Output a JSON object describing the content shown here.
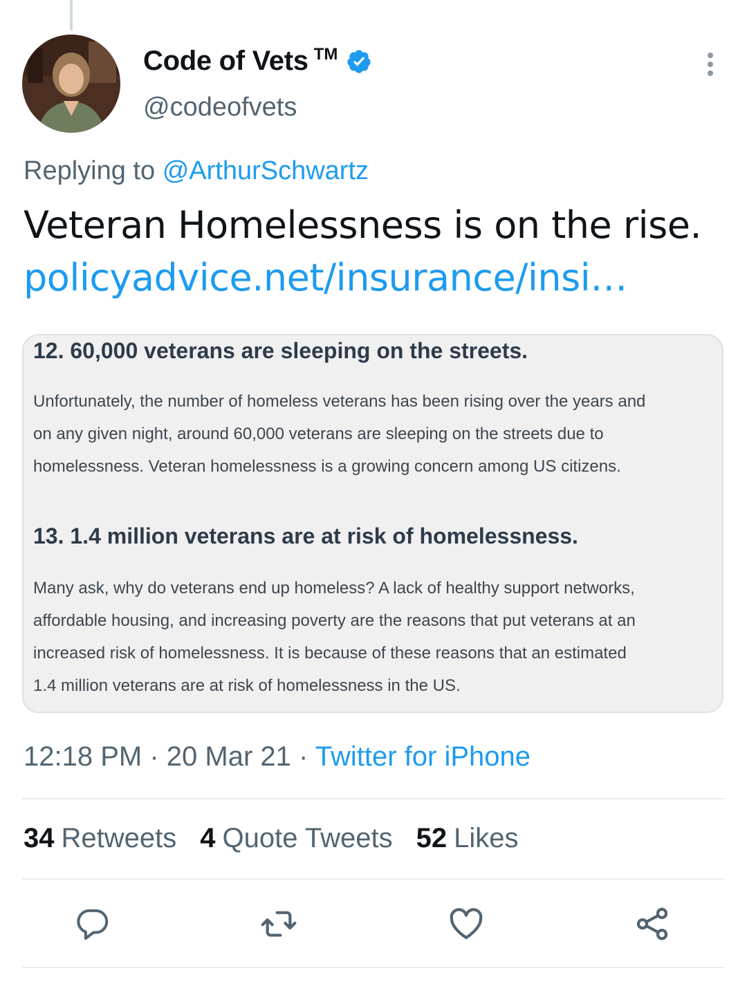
{
  "tweet": {
    "author": {
      "display_name": "Code of Vets",
      "tm": "TM",
      "handle": "@codeofvets"
    },
    "replying": {
      "prefix": "Replying to",
      "mention": "@ArthurSchwartz"
    },
    "text": "Veteran Homelessness is on the rise.",
    "link": "policyadvice.net/insurance/insi…",
    "media": {
      "heading_1": "12. 60,000 veterans are sleeping on the streets.",
      "para_1": [
        "Unfortunately, the number of homeless veterans has been rising over the years and",
        "on any given night, around 60,000 veterans are sleeping on the streets due to",
        "homelessness. Veteran homelessness is a growing concern among US citizens."
      ],
      "heading_2": "13. 1.4 million veterans are at risk of homelessness.",
      "para_2": [
        "Many ask, why do veterans end up homeless? A lack of healthy support networks,",
        "affordable housing, and increasing poverty are the reasons that put veterans at an",
        "increased risk of homelessness. It is because of these reasons that an estimated",
        "1.4 million veterans are at risk of homelessness in the US."
      ]
    },
    "time": "12:18 PM",
    "sep": "·",
    "date": "20 Mar 21",
    "source": "Twitter for iPhone",
    "stats": {
      "retweets_count": "34",
      "retweets_label": "Retweets",
      "quotes_count": "4",
      "quotes_label": "Quote Tweets",
      "likes_count": "52",
      "likes_label": "Likes"
    }
  },
  "icons": {
    "verified": "verified-badge-icon",
    "more": "more-vertical-icon",
    "reply": "reply-icon",
    "retweet": "retweet-icon",
    "like": "heart-icon",
    "share": "share-icon"
  },
  "colors": {
    "accent": "#1d9bf0",
    "text": "#0f1419",
    "secondary": "#536471"
  }
}
